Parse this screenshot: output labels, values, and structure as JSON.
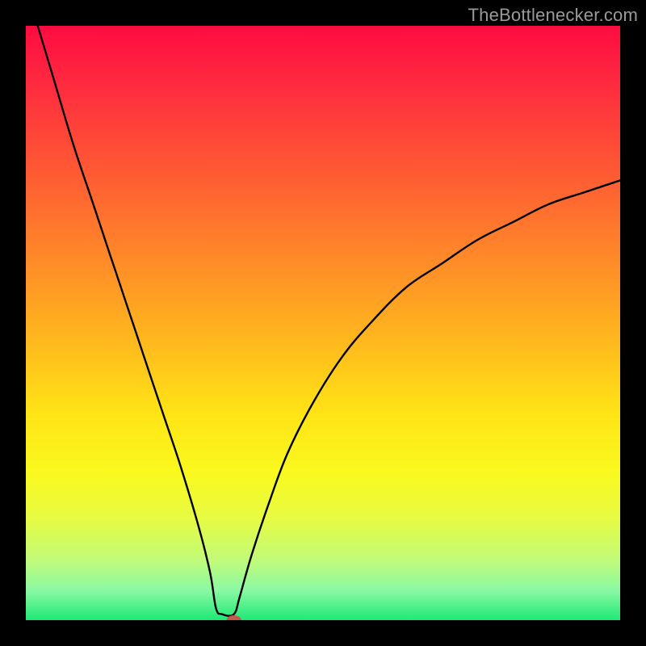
{
  "watermark": "TheBottlenecker.com",
  "chart_data": {
    "type": "line",
    "title": "",
    "xlabel": "",
    "ylabel": "",
    "xlim": [
      0,
      100
    ],
    "ylim": [
      0,
      100
    ],
    "axes_visible": false,
    "grid": false,
    "background_gradient": {
      "stops": [
        {
          "offset": 0.0,
          "color": "#ff0b41"
        },
        {
          "offset": 0.1,
          "color": "#ff2b3f"
        },
        {
          "offset": 0.25,
          "color": "#ff5b33"
        },
        {
          "offset": 0.4,
          "color": "#ff8c28"
        },
        {
          "offset": 0.55,
          "color": "#ffbf1c"
        },
        {
          "offset": 0.65,
          "color": "#ffe316"
        },
        {
          "offset": 0.75,
          "color": "#faf91e"
        },
        {
          "offset": 0.83,
          "color": "#e6fb43"
        },
        {
          "offset": 0.9,
          "color": "#c0fb7a"
        },
        {
          "offset": 0.95,
          "color": "#8af9a4"
        },
        {
          "offset": 1.0,
          "color": "#1ee876"
        }
      ]
    },
    "curve": {
      "description": "bottleneck V-curve",
      "min_point_x": 33,
      "points": [
        {
          "x": 2,
          "y": 100
        },
        {
          "x": 5,
          "y": 90
        },
        {
          "x": 8,
          "y": 80
        },
        {
          "x": 11,
          "y": 71
        },
        {
          "x": 14,
          "y": 62
        },
        {
          "x": 17,
          "y": 53
        },
        {
          "x": 20,
          "y": 44
        },
        {
          "x": 23,
          "y": 35
        },
        {
          "x": 26,
          "y": 26
        },
        {
          "x": 29,
          "y": 16
        },
        {
          "x": 31,
          "y": 8
        },
        {
          "x": 32,
          "y": 2
        },
        {
          "x": 33,
          "y": 1
        },
        {
          "x": 35,
          "y": 1
        },
        {
          "x": 36,
          "y": 4
        },
        {
          "x": 38,
          "y": 11
        },
        {
          "x": 41,
          "y": 20
        },
        {
          "x": 44,
          "y": 28
        },
        {
          "x": 48,
          "y": 36
        },
        {
          "x": 53,
          "y": 44
        },
        {
          "x": 58,
          "y": 50
        },
        {
          "x": 64,
          "y": 56
        },
        {
          "x": 70,
          "y": 60
        },
        {
          "x": 76,
          "y": 64
        },
        {
          "x": 82,
          "y": 67
        },
        {
          "x": 88,
          "y": 70
        },
        {
          "x": 94,
          "y": 72
        },
        {
          "x": 100,
          "y": 74
        }
      ]
    },
    "marker": {
      "x": 35,
      "y": 0,
      "color": "#c45a4a",
      "rx": 9,
      "ry": 6
    }
  }
}
